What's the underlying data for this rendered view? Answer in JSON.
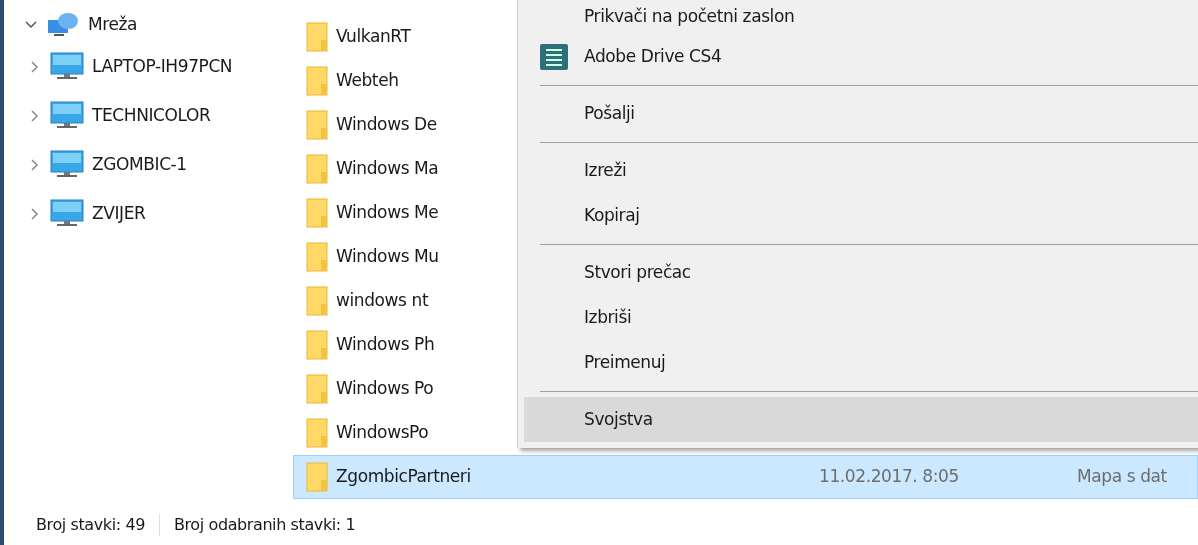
{
  "navigation_tree": {
    "items": [
      {
        "label": "Mreža",
        "kind": "network",
        "expanded": true,
        "children": [
          {
            "label": "LAPTOP-IH97PCN",
            "kind": "computer",
            "expanded": false
          },
          {
            "label": "TECHNICOLOR",
            "kind": "computer",
            "expanded": false
          },
          {
            "label": "ZGOMBIC-1",
            "kind": "computer",
            "expanded": false
          },
          {
            "label": "ZVIJER",
            "kind": "computer",
            "expanded": false
          }
        ]
      }
    ]
  },
  "file_list": {
    "rows": [
      {
        "name": "VulkanRT",
        "selected": false
      },
      {
        "name": "Webteh",
        "selected": false
      },
      {
        "name": "Windows De",
        "selected": false
      },
      {
        "name": "Windows Ma",
        "selected": false
      },
      {
        "name": "Windows Me",
        "selected": false
      },
      {
        "name": "Windows Mu",
        "selected": false
      },
      {
        "name": "windows nt",
        "selected": false
      },
      {
        "name": "Windows Ph",
        "selected": false
      },
      {
        "name": "Windows Po",
        "selected": false
      },
      {
        "name": "WindowsPo",
        "selected": false
      },
      {
        "name": "ZgombicPartneri",
        "selected": true,
        "date_modified": "11.02.2017. 8:05",
        "type": "Mapa s dat"
      }
    ]
  },
  "context_menu": {
    "items": [
      {
        "kind": "item",
        "label": "Prikvači na početni zaslon",
        "highlighted": false
      },
      {
        "kind": "app",
        "label": "Adobe Drive CS4",
        "highlighted": false
      },
      {
        "kind": "separator"
      },
      {
        "kind": "item",
        "label": "Pošalji",
        "highlighted": false
      },
      {
        "kind": "separator"
      },
      {
        "kind": "item",
        "label": "Izreži",
        "highlighted": false
      },
      {
        "kind": "item",
        "label": "Kopiraj",
        "highlighted": false
      },
      {
        "kind": "separator"
      },
      {
        "kind": "item",
        "label": "Stvori prečac",
        "highlighted": false
      },
      {
        "kind": "item",
        "label": "Izbriši",
        "highlighted": false
      },
      {
        "kind": "item",
        "label": "Preimenuj",
        "highlighted": false
      },
      {
        "kind": "separator"
      },
      {
        "kind": "item",
        "label": "Svojstva",
        "highlighted": true
      }
    ]
  },
  "status_bar": {
    "item_count": "Broj stavki: 49",
    "selected_count": "Broj odabranih stavki: 1"
  }
}
